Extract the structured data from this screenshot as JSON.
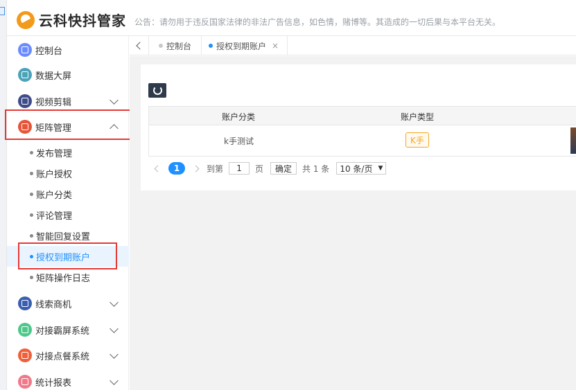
{
  "brand": {
    "name": "云科快抖管家"
  },
  "notice": "公告：请勿用于违反国家法律的非法广告信息，如色情，赌博等。其造成的一切后果与本平台无关。",
  "colors": {
    "accent": "#1e90ff",
    "highlight": "#e53935",
    "badge": "#f5a623",
    "dark_button": "#2f3a4a"
  },
  "sidebar": {
    "items": [
      {
        "label": "控制台",
        "icon": "monitor-icon",
        "color": "#6b8cff"
      },
      {
        "label": "数据大屏",
        "icon": "screen-icon",
        "color": "#4aa3b8"
      },
      {
        "label": "视频剪辑",
        "icon": "video-edit-icon",
        "color": "#3e4d8a"
      },
      {
        "label": "矩阵管理",
        "icon": "grid-icon",
        "color": "#e8543a"
      },
      {
        "label": "线索商机",
        "icon": "lead-icon",
        "color": "#3b5fb0"
      },
      {
        "label": "对接霸屏系统",
        "icon": "phone-icon",
        "color": "#4cc98a"
      },
      {
        "label": "对接点餐系统",
        "icon": "order-icon",
        "color": "#f0603a"
      },
      {
        "label": "统计报表",
        "icon": "chart-icon",
        "color": "#f07a8a"
      }
    ],
    "matrix_sub": [
      "发布管理",
      "账户授权",
      "账户分类",
      "评论管理",
      "智能回复设置",
      "授权到期账户",
      "矩阵操作日志"
    ]
  },
  "tabs": [
    {
      "label": "控制台"
    },
    {
      "label": "授权到期账户",
      "close": "×"
    }
  ],
  "table": {
    "headers": [
      "账户分类",
      "账户类型"
    ],
    "rows": [
      {
        "category": "k手测试",
        "type": "K手"
      }
    ]
  },
  "pagination": {
    "current": "1",
    "goto_label": "到第",
    "goto_value": "1",
    "page_unit": "页",
    "confirm": "确定",
    "total": "共 1 条",
    "page_size": "10 条/页",
    "caret": "▼"
  }
}
